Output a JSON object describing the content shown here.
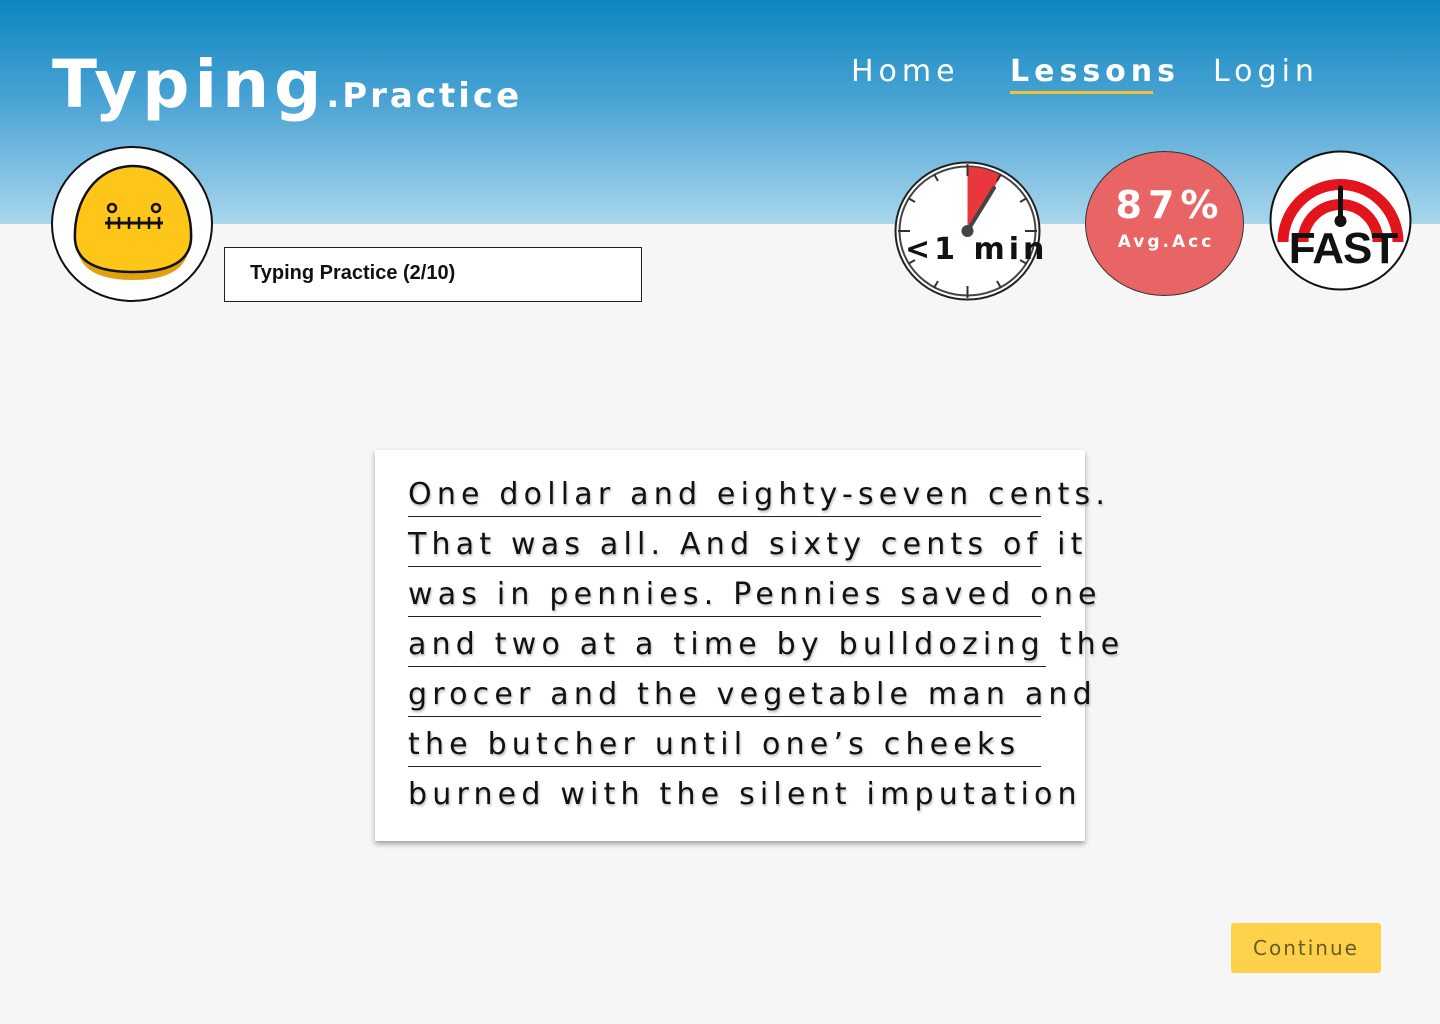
{
  "app": {
    "logo_main": "Typing",
    "logo_sub": ".Practice"
  },
  "nav": {
    "items": [
      {
        "label": "Home"
      },
      {
        "label": "Lessons",
        "active": true
      },
      {
        "label": "Login"
      }
    ]
  },
  "lesson": {
    "title": "Typing Practice (2/10)"
  },
  "stats": {
    "timer_label": "<1 min",
    "accuracy_value": "87%",
    "accuracy_label": "Avg.Acc",
    "speed_badge": "FAST"
  },
  "passage": {
    "lines": [
      "One dollar and eighty-seven cents.",
      "That was all. And sixty cents of it",
      "was in pennies. Pennies saved one",
      "and two at a time by bulldozing the",
      "grocer and the vegetable man and",
      "the butcher until one’s cheeks",
      "burned with the silent imputation"
    ]
  },
  "actions": {
    "continue_label": "Continue"
  },
  "colors": {
    "header_top": "#0d86bf",
    "header_bottom": "#a9d6ec",
    "accent_underline": "#f2c230",
    "accuracy_bg": "#e96565",
    "continue_bg": "#fdd14a",
    "avatar_yellow": "#ffc61a"
  },
  "icons": {
    "avatar": "zipped-mouth-blob-icon",
    "timer": "stopwatch-icon",
    "speed": "fast-speedometer-icon"
  }
}
